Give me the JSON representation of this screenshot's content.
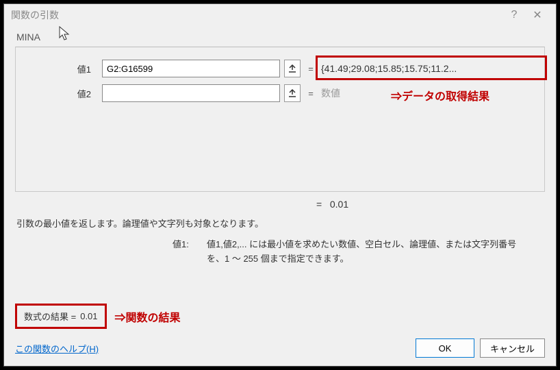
{
  "title": "関数の引数",
  "func_name": "MINA",
  "rows": [
    {
      "label": "値1",
      "value": "G2:G16599",
      "preview": "{41.49;29.08;15.85;15.75;11.2..."
    },
    {
      "label": "値2",
      "value": "",
      "preview": "数値"
    }
  ],
  "mid_result": {
    "eq": "=",
    "val": "0.01"
  },
  "description": "引数の最小値を返します。論理値や文字列も対象となります。",
  "arg_desc": {
    "label": "値1:",
    "text": "値1,値2,... には最小値を求めたい数値、空白セル、論理値、または文字列番号を、1 ～ 255 個まで指定できます。"
  },
  "formula_result": {
    "label": "数式の結果 =",
    "val": "0.01"
  },
  "help_link": "この関数のヘルプ(H)",
  "buttons": {
    "ok": "OK",
    "cancel": "キャンセル"
  },
  "annotations": {
    "a1": "⇒データの取得結果",
    "a2": "⇒関数の結果"
  }
}
